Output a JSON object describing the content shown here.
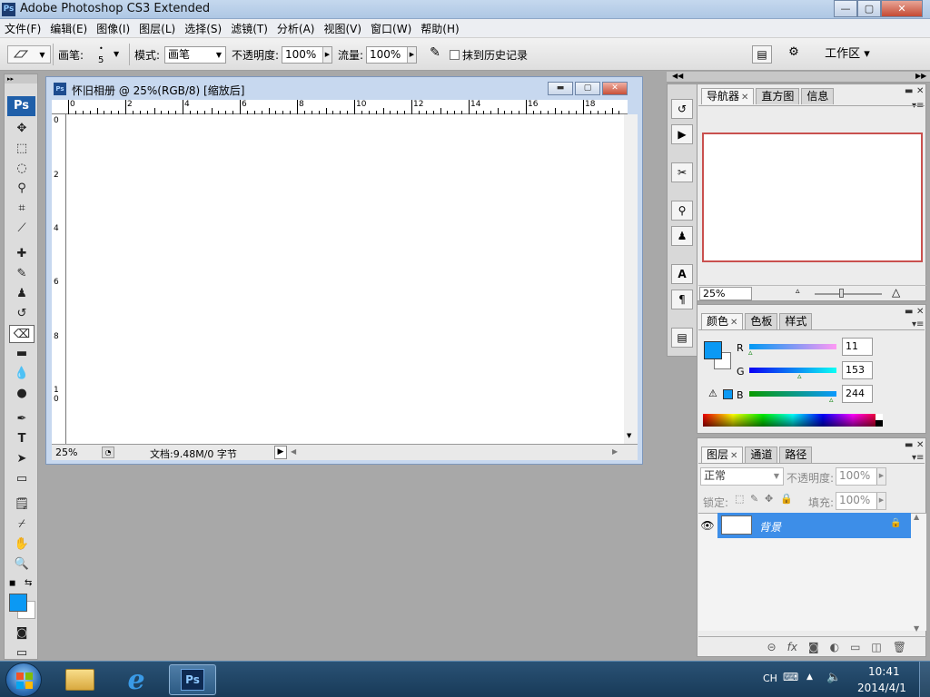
{
  "window": {
    "title": "Adobe Photoshop CS3 Extended",
    "logo": "Ps",
    "min": "—",
    "max": "▢",
    "close": "✕"
  },
  "menu": [
    "文件(F)",
    "编辑(E)",
    "图像(I)",
    "图层(L)",
    "选择(S)",
    "滤镜(T)",
    "分析(A)",
    "视图(V)",
    "窗口(W)",
    "帮助(H)"
  ],
  "options": {
    "brush_label": "画笔:",
    "brush_size": "5",
    "mode_label": "模式:",
    "mode_value": "画笔",
    "opacity_label": "不透明度:",
    "opacity_value": "100%",
    "flow_label": "流量:",
    "flow_value": "100%",
    "erase_history_label": "抹到历史记录",
    "workspace_label": "工作区 ▾"
  },
  "toolbox": {
    "logo": "Ps"
  },
  "document": {
    "icon": "Ps",
    "title": "怀旧相册 @ 25%(RGB/8) [缩放后]",
    "ruler_top": [
      "0",
      "2",
      "4",
      "6",
      "8",
      "10",
      "12",
      "14",
      "16",
      "18"
    ],
    "ruler_left": [
      "0",
      "2",
      "4",
      "6",
      "8",
      "1\n0"
    ],
    "zoom": "25%",
    "doc_info": "文档:9.48M/0 字节"
  },
  "navigator": {
    "tabs": [
      "导航器",
      "直方图",
      "信息"
    ],
    "zoom": "25%"
  },
  "color": {
    "tabs": [
      "颜色",
      "色板",
      "样式"
    ],
    "channels": [
      {
        "name": "R",
        "value": "11"
      },
      {
        "name": "G",
        "value": "153"
      },
      {
        "name": "B",
        "value": "244"
      }
    ],
    "foreground": "#0b99f4"
  },
  "layers": {
    "tabs": [
      "图层",
      "通道",
      "路径"
    ],
    "blend_mode": "正常",
    "opacity_label": "不透明度:",
    "opacity_value": "100%",
    "lock_label": "锁定:",
    "fill_label": "填充:",
    "fill_value": "100%",
    "layer_name": "背景"
  },
  "taskbar": {
    "lang": "CH",
    "time": "10:41",
    "date": "2014/4/1"
  }
}
